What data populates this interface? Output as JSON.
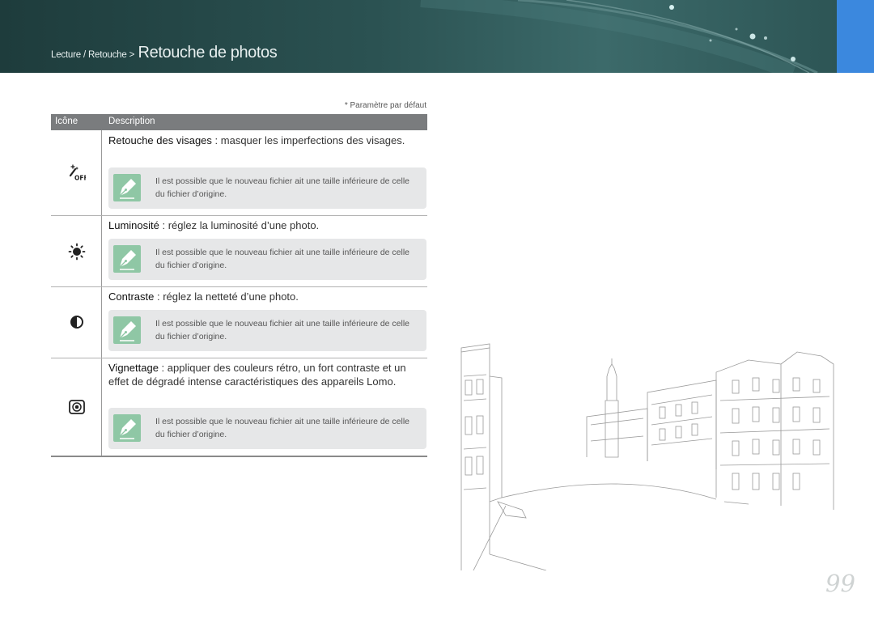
{
  "header": {
    "breadcrumb_path": "Lecture / Retouche >",
    "title": "Retouche de photos",
    "banner_color": "#2b5252",
    "tab_color": "#3b88de"
  },
  "table": {
    "default_note": "* Paramètre par défaut",
    "col_icon": "Icône",
    "col_description": "Description",
    "rows": [
      {
        "icon": "face-retouch-off-icon",
        "term": "Retouche des visages",
        "text": " : masquer les imperfections des visages.",
        "note": "Il est possible que le nouveau fichier ait une taille inférieure de celle du fichier d’origine."
      },
      {
        "icon": "brightness-icon",
        "term": "Luminosité",
        "text": " : réglez la luminosité d’une photo.",
        "note": "Il est possible que le nouveau fichier ait une taille inférieure de celle du fichier d’origine."
      },
      {
        "icon": "contrast-icon",
        "term": "Contraste",
        "text": " : réglez la netteté d’une photo.",
        "note": "Il est possible que le nouveau fichier ait une taille inférieure de celle du fichier d’origine."
      },
      {
        "icon": "vignetting-icon",
        "term": "Vignettage",
        "text": " : appliquer des couleurs rétro, un fort contraste et un effet de dégradé intense caractéristiques des appareils Lomo.",
        "note": "Il est possible que le nouveau fichier ait une taille inférieure de celle du fichier d’origine."
      }
    ]
  },
  "note_icon_color": "#8fc7a5",
  "page_number": "99"
}
